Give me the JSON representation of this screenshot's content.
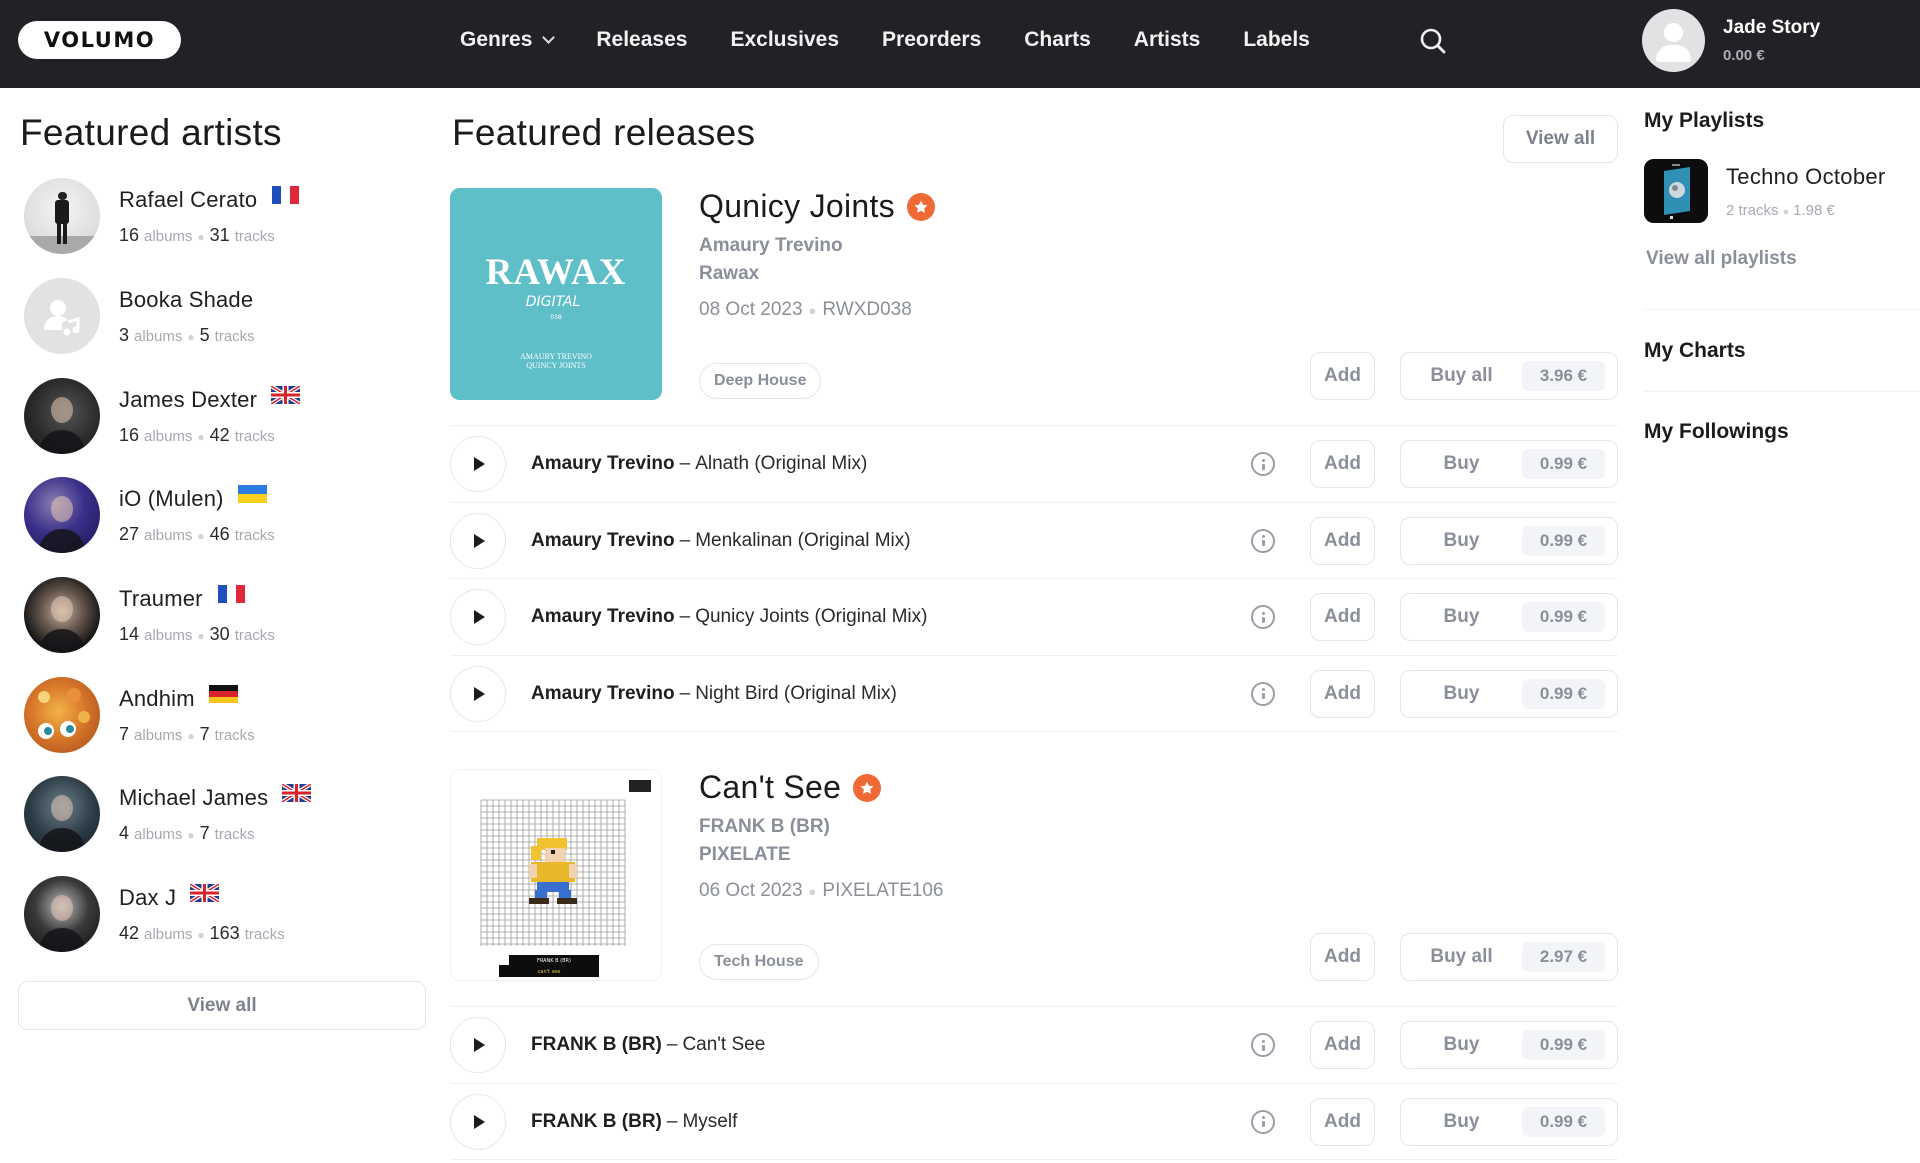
{
  "header": {
    "logo": "VOLUMO",
    "nav": [
      {
        "label": "Genres",
        "has_dropdown": true
      },
      {
        "label": "Releases"
      },
      {
        "label": "Exclusives"
      },
      {
        "label": "Preorders"
      },
      {
        "label": "Charts"
      },
      {
        "label": "Artists"
      },
      {
        "label": "Labels"
      }
    ],
    "search_icon": "search-icon",
    "user": {
      "name": "Jade Story",
      "balance": "0.00 €"
    }
  },
  "featured_artists": {
    "title": "Featured artists",
    "albums_unit": "albums",
    "tracks_unit": "tracks",
    "items": [
      {
        "name": "Rafael Cerato",
        "flag": "France",
        "albums": "16",
        "tracks": "31"
      },
      {
        "name": "Booka Shade",
        "flag": "",
        "albums": "3",
        "tracks": "5"
      },
      {
        "name": "James Dexter",
        "flag": "United Kingdom",
        "albums": "16",
        "tracks": "42"
      },
      {
        "name": "iO (Mulen)",
        "flag": "Ukraine",
        "albums": "27",
        "tracks": "46"
      },
      {
        "name": "Traumer",
        "flag": "France",
        "albums": "14",
        "tracks": "30"
      },
      {
        "name": "Andhim",
        "flag": "Germany",
        "albums": "7",
        "tracks": "7"
      },
      {
        "name": "Michael James",
        "flag": "United Kingdom",
        "albums": "4",
        "tracks": "7"
      },
      {
        "name": "Dax J",
        "flag": "United Kingdom",
        "albums": "42",
        "tracks": "163"
      }
    ],
    "view_all": "View all"
  },
  "featured_releases": {
    "title": "Featured releases",
    "view_all": "View all",
    "add_label": "Add",
    "buy_all_label": "Buy all",
    "buy_label": "Buy",
    "releases": [
      {
        "title": "Qunicy Joints",
        "artist": "Amaury Trevino",
        "label": "Rawax",
        "date": "08 Oct 2023",
        "catalog": "RWXD038",
        "genre": "Deep House",
        "buy_all_price": "3.96 €",
        "artwork": {
          "brand": "RAWAX",
          "sub": "DIGITAL",
          "num": "038",
          "line1": "AMAURY TREVINO",
          "line2": "QUINCY JOINTS",
          "color": "#5fbfc9"
        },
        "tracks": [
          {
            "artist": "Amaury Trevino",
            "title": "Alnath (Original Mix)",
            "price": "0.99 €"
          },
          {
            "artist": "Amaury Trevino",
            "title": "Menkalinan (Original Mix)",
            "price": "0.99 €"
          },
          {
            "artist": "Amaury Trevino",
            "title": "Qunicy Joints (Original Mix)",
            "price": "0.99 €"
          },
          {
            "artist": "Amaury Trevino",
            "title": "Night Bird (Original Mix)",
            "price": "0.99 €"
          }
        ]
      },
      {
        "title": "Can't See",
        "artist": "FRANK B (BR)",
        "label": "PIXELATE",
        "date": "06 Oct 2023",
        "catalog": "PIXELATE106",
        "genre": "Tech House",
        "buy_all_price": "2.97 €",
        "artwork": {
          "line1": "FRANK B (BR)",
          "line2": "can't see"
        },
        "tracks": [
          {
            "artist": "FRANK B (BR)",
            "title": "Can't See",
            "price": "0.99 €"
          },
          {
            "artist": "FRANK B (BR)",
            "title": "Myself",
            "price": "0.99 €"
          }
        ]
      }
    ]
  },
  "sidebar": {
    "playlists_title": "My Playlists",
    "playlist": {
      "name": "Techno October",
      "tracks": "2 tracks",
      "price": "1.98 €"
    },
    "view_all_playlists": "View all playlists",
    "charts_title": "My Charts",
    "followings_title": "My Followings"
  },
  "colors": {
    "header_bg": "#222226",
    "accent_star": "#f06a35",
    "muted_text": "#8b8f99",
    "border": "#e4e5e8"
  }
}
